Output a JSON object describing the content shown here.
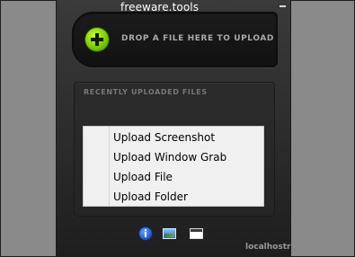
{
  "window": {
    "title": "freeware.tools"
  },
  "dropzone": {
    "label": "DROP A FILE HERE TO UPLOAD",
    "icon": "plus-icon"
  },
  "recent": {
    "title": "RECENTLY UPLOADED FILES"
  },
  "context_menu": {
    "items": [
      {
        "label": "Upload Screenshot"
      },
      {
        "label": "Upload Window Grab"
      },
      {
        "label": "Upload File"
      },
      {
        "label": "Upload Folder"
      }
    ]
  },
  "footer": {
    "icons": [
      "info-icon",
      "image-icon",
      "window-icon"
    ],
    "brand": "localhostr"
  },
  "colors": {
    "accent_green": "#8ad400",
    "panel_dark": "#2a2a2a",
    "menu_bg": "#f0f0f0"
  }
}
